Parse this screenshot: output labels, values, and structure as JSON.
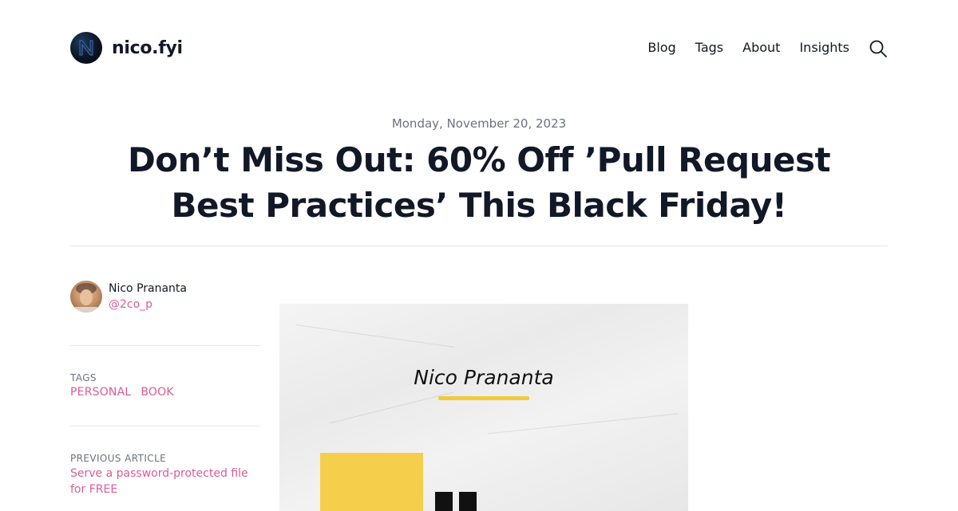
{
  "site": {
    "name": "nico.fyi",
    "logo_icon": "n-logo-icon"
  },
  "nav": {
    "items": [
      "Blog",
      "Tags",
      "About",
      "Insights"
    ],
    "search_icon": "search-icon"
  },
  "article": {
    "date": "Monday, November 20, 2023",
    "title": "Don’t Miss Out: 60% Off ’Pull Request Best Practices’ This Black Friday!"
  },
  "author": {
    "name": "Nico Prananta",
    "handle": "@2co_p"
  },
  "tags": {
    "label": "TAGS",
    "items": [
      "PERSONAL",
      "BOOK"
    ]
  },
  "previous": {
    "label": "PREVIOUS ARTICLE",
    "title": "Serve a password-protected file for FREE"
  },
  "hero": {
    "author": "Nico Prananta"
  },
  "colors": {
    "accent": "#db5b95",
    "highlight": "#f2cb3c",
    "text": "#111827",
    "muted": "#6b7280"
  }
}
